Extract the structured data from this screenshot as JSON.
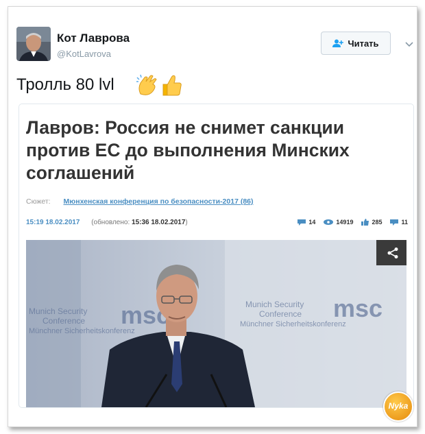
{
  "user": {
    "name": "Кот Лаврова",
    "handle": "@KotLavrova"
  },
  "follow_button": {
    "label": "Читать"
  },
  "tweet": {
    "text": "Тролль 80 lvl"
  },
  "card": {
    "headline": "Лавров: Россия не снимет санкции против ЕС до выполнения Минских соглашений",
    "story_label": "Сюжет:",
    "story_link": "Мюнхенская конференция по безопасности-2017 (86)",
    "published": "15:19 18.02.2017",
    "updated_label": "(обновлено:",
    "updated_value": "15:36 18.02.2017",
    "updated_close": ")",
    "stats": {
      "comments": "14",
      "views": "14919",
      "likes": "285",
      "reposts": "11"
    }
  },
  "photo": {
    "banner_line1": "Munich Security",
    "banner_line2": "Conference",
    "banner_line3": "Münchner Sicherheitskonferenz",
    "banner_logo": "msc"
  },
  "watermark": {
    "text": "Nyka"
  },
  "colors": {
    "link": "#4a8ec2",
    "follow_icon": "#1da1f2",
    "share_bg": "#3a3a3a"
  }
}
